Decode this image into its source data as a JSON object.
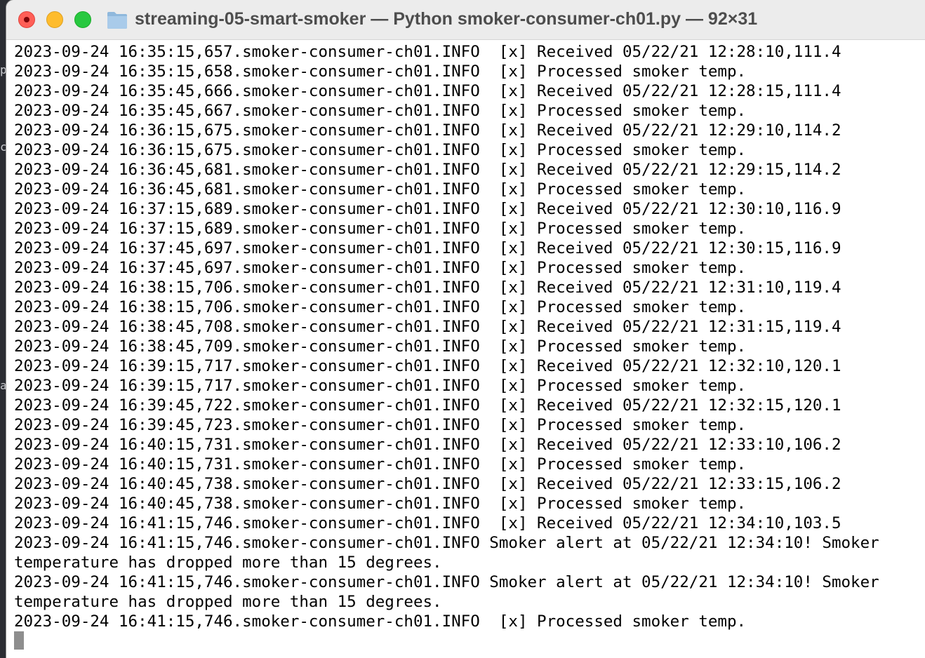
{
  "window": {
    "title": "streaming-05-smart-smoker — Python smoker-consumer-ch01.py — 92×31",
    "folder_icon": "folder-icon",
    "buttons": {
      "close": "close-button",
      "minimize": "minimize-button",
      "zoom": "zoom-button"
    }
  },
  "colors": {
    "close": "#ff5f57",
    "minimize": "#febc2e",
    "zoom": "#28c840",
    "titlebar": "#ececec",
    "background": "#ffffff",
    "text": "#000000"
  },
  "terminal": {
    "lines": [
      "2023-09-24 16:35:15,657.smoker-consumer-ch01.INFO  [x] Received 05/22/21 12:28:10,111.4",
      "2023-09-24 16:35:15,658.smoker-consumer-ch01.INFO  [x] Processed smoker temp.",
      "2023-09-24 16:35:45,666.smoker-consumer-ch01.INFO  [x] Received 05/22/21 12:28:15,111.4",
      "2023-09-24 16:35:45,667.smoker-consumer-ch01.INFO  [x] Processed smoker temp.",
      "2023-09-24 16:36:15,675.smoker-consumer-ch01.INFO  [x] Received 05/22/21 12:29:10,114.2",
      "2023-09-24 16:36:15,675.smoker-consumer-ch01.INFO  [x] Processed smoker temp.",
      "2023-09-24 16:36:45,681.smoker-consumer-ch01.INFO  [x] Received 05/22/21 12:29:15,114.2",
      "2023-09-24 16:36:45,681.smoker-consumer-ch01.INFO  [x] Processed smoker temp.",
      "2023-09-24 16:37:15,689.smoker-consumer-ch01.INFO  [x] Received 05/22/21 12:30:10,116.9",
      "2023-09-24 16:37:15,689.smoker-consumer-ch01.INFO  [x] Processed smoker temp.",
      "2023-09-24 16:37:45,697.smoker-consumer-ch01.INFO  [x] Received 05/22/21 12:30:15,116.9",
      "2023-09-24 16:37:45,697.smoker-consumer-ch01.INFO  [x] Processed smoker temp.",
      "2023-09-24 16:38:15,706.smoker-consumer-ch01.INFO  [x] Received 05/22/21 12:31:10,119.4",
      "2023-09-24 16:38:15,706.smoker-consumer-ch01.INFO  [x] Processed smoker temp.",
      "2023-09-24 16:38:45,708.smoker-consumer-ch01.INFO  [x] Received 05/22/21 12:31:15,119.4",
      "2023-09-24 16:38:45,709.smoker-consumer-ch01.INFO  [x] Processed smoker temp.",
      "2023-09-24 16:39:15,717.smoker-consumer-ch01.INFO  [x] Received 05/22/21 12:32:10,120.1",
      "2023-09-24 16:39:15,717.smoker-consumer-ch01.INFO  [x] Processed smoker temp.",
      "2023-09-24 16:39:45,722.smoker-consumer-ch01.INFO  [x] Received 05/22/21 12:32:15,120.1",
      "2023-09-24 16:39:45,723.smoker-consumer-ch01.INFO  [x] Processed smoker temp.",
      "2023-09-24 16:40:15,731.smoker-consumer-ch01.INFO  [x] Received 05/22/21 12:33:10,106.2",
      "2023-09-24 16:40:15,731.smoker-consumer-ch01.INFO  [x] Processed smoker temp.",
      "2023-09-24 16:40:45,738.smoker-consumer-ch01.INFO  [x] Received 05/22/21 12:33:15,106.2",
      "2023-09-24 16:40:45,738.smoker-consumer-ch01.INFO  [x] Processed smoker temp.",
      "2023-09-24 16:41:15,746.smoker-consumer-ch01.INFO  [x] Received 05/22/21 12:34:10,103.5",
      "2023-09-24 16:41:15,746.smoker-consumer-ch01.INFO Smoker alert at 05/22/21 12:34:10! Smoker",
      "temperature has dropped more than 15 degrees.",
      "2023-09-24 16:41:15,746.smoker-consumer-ch01.INFO Smoker alert at 05/22/21 12:34:10! Smoker",
      "temperature has dropped more than 15 degrees.",
      "2023-09-24 16:41:15,746.smoker-consumer-ch01.INFO  [x] Processed smoker temp.",
      ""
    ]
  }
}
